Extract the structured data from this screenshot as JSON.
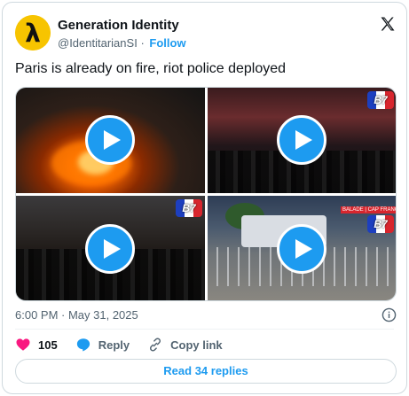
{
  "author": {
    "name": "Generation Identity",
    "handle": "@IdentitarianSI",
    "separator": "·",
    "follow_label": "Follow",
    "avatar_symbol": "λ"
  },
  "tweet": {
    "text": "Paris is already on fire, riot police deployed",
    "timestamp": "6:00 PM · May 31, 2025"
  },
  "media": {
    "badges": [
      "B7",
      "B7",
      "B7"
    ],
    "ticker": "BALADE | CAP FRANCE"
  },
  "actions": {
    "like_count": "105",
    "reply_label": "Reply",
    "copy_link_label": "Copy link"
  },
  "read_replies_label": "Read 34 replies",
  "colors": {
    "accent": "#1d9bf0",
    "like": "#f91880",
    "avatar_bg": "#f7c400",
    "secondary_text": "#536471"
  },
  "icons": [
    "x-logo-icon",
    "play-icon",
    "info-icon",
    "heart-icon",
    "reply-bubble-icon",
    "link-icon"
  ]
}
